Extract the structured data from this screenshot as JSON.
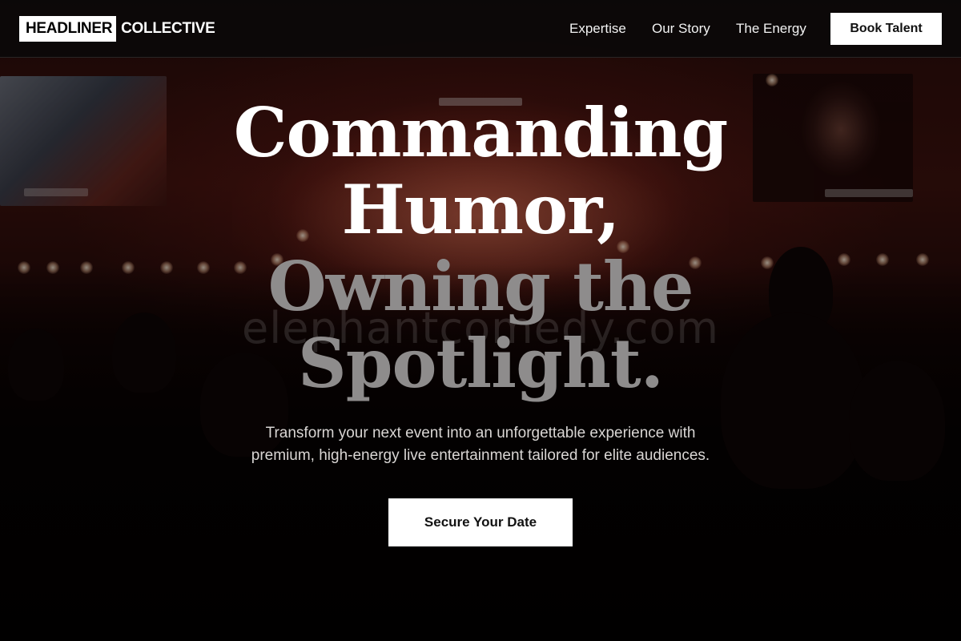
{
  "nav": {
    "logo_box": "HEADLINER",
    "logo_rest": "COLLECTIVE",
    "links": [
      "Expertise",
      "Our Story",
      "The Energy"
    ],
    "cta_label": "Book Talent"
  },
  "hero": {
    "headline_lines": [
      "Commanding",
      "Humor,",
      "Owning the",
      "Spotlight."
    ],
    "subtitle_line1": "Transform your next event into an unforgettable experience with",
    "subtitle_line2": "premium, high-energy live entertainment tailored for elite audiences.",
    "cta_label": "Secure Your Date",
    "watermark": "elephantcomedy.com"
  },
  "colors": {
    "headline_primary": "#ffffff",
    "headline_secondary": "#8e8c8c",
    "button_bg": "#ffffff",
    "button_text": "#111111",
    "nav_bg": "#080808"
  }
}
